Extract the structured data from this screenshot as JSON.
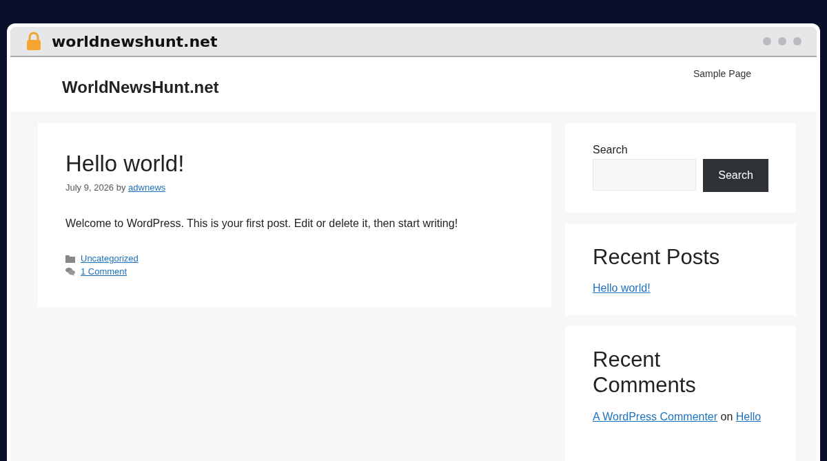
{
  "browser": {
    "address": "worldnewshunt.net"
  },
  "site": {
    "title": "WorldNewsHunt.net",
    "nav": [
      "Sample Page"
    ]
  },
  "post": {
    "title": "Hello world!",
    "date": "July 9, 2026",
    "by": "by",
    "author": "adwnews",
    "body": "Welcome to WordPress. This is your first post. Edit or delete it, then start writing!",
    "category": "Uncategorized",
    "comments": "1 Comment"
  },
  "sidebar": {
    "search": {
      "label": "Search",
      "button": "Search"
    },
    "recent_posts": {
      "title": "Recent Posts",
      "items": [
        "Hello world!"
      ]
    },
    "recent_comments": {
      "title": "Recent Comments",
      "items": [
        {
          "author": "A WordPress Commenter",
          "on": "on",
          "post": "Hello"
        }
      ]
    }
  }
}
